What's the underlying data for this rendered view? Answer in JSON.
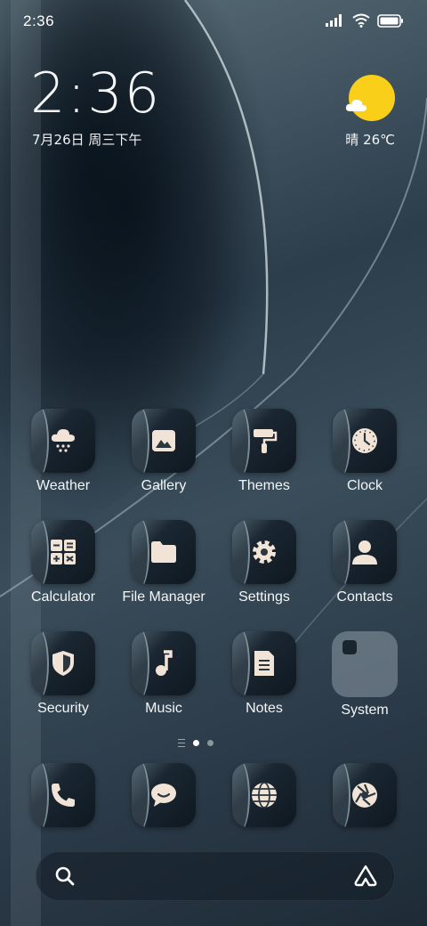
{
  "status_bar": {
    "time": "2:36",
    "icons": [
      "signal-icon",
      "wifi-icon",
      "battery-icon"
    ]
  },
  "clock_widget": {
    "time": "2:36",
    "date": "7月26日 周三下午"
  },
  "weather_widget": {
    "icon": "sun-cloud-icon",
    "text": "晴 26℃",
    "sun_color": "#f9cf1a"
  },
  "apps": [
    {
      "label": "Weather",
      "icon": "snow-cloud-icon"
    },
    {
      "label": "Gallery",
      "icon": "image-icon"
    },
    {
      "label": "Themes",
      "icon": "paint-roller-icon"
    },
    {
      "label": "Clock",
      "icon": "clock-icon"
    },
    {
      "label": "Calculator",
      "icon": "calculator-icon"
    },
    {
      "label": "File Manager",
      "icon": "folder-icon"
    },
    {
      "label": "Settings",
      "icon": "gear-icon"
    },
    {
      "label": "Contacts",
      "icon": "person-icon"
    },
    {
      "label": "Security",
      "icon": "shield-icon"
    },
    {
      "label": "Music",
      "icon": "music-note-icon"
    },
    {
      "label": "Notes",
      "icon": "note-icon"
    },
    {
      "label": "System",
      "icon": "folder-group"
    }
  ],
  "page_indicator": {
    "pages": 2,
    "active": 1
  },
  "dock": [
    {
      "name": "phone",
      "icon": "phone-icon"
    },
    {
      "name": "messages",
      "icon": "chat-bubble-icon"
    },
    {
      "name": "browser",
      "icon": "globe-icon"
    },
    {
      "name": "camera",
      "icon": "aperture-icon"
    }
  ],
  "search_bar": {
    "left_icon": "search-icon",
    "right_icon": "assistant-icon"
  },
  "colors": {
    "icon_glyph": "#f1e4d6",
    "accent_sun": "#f9cf1a"
  }
}
